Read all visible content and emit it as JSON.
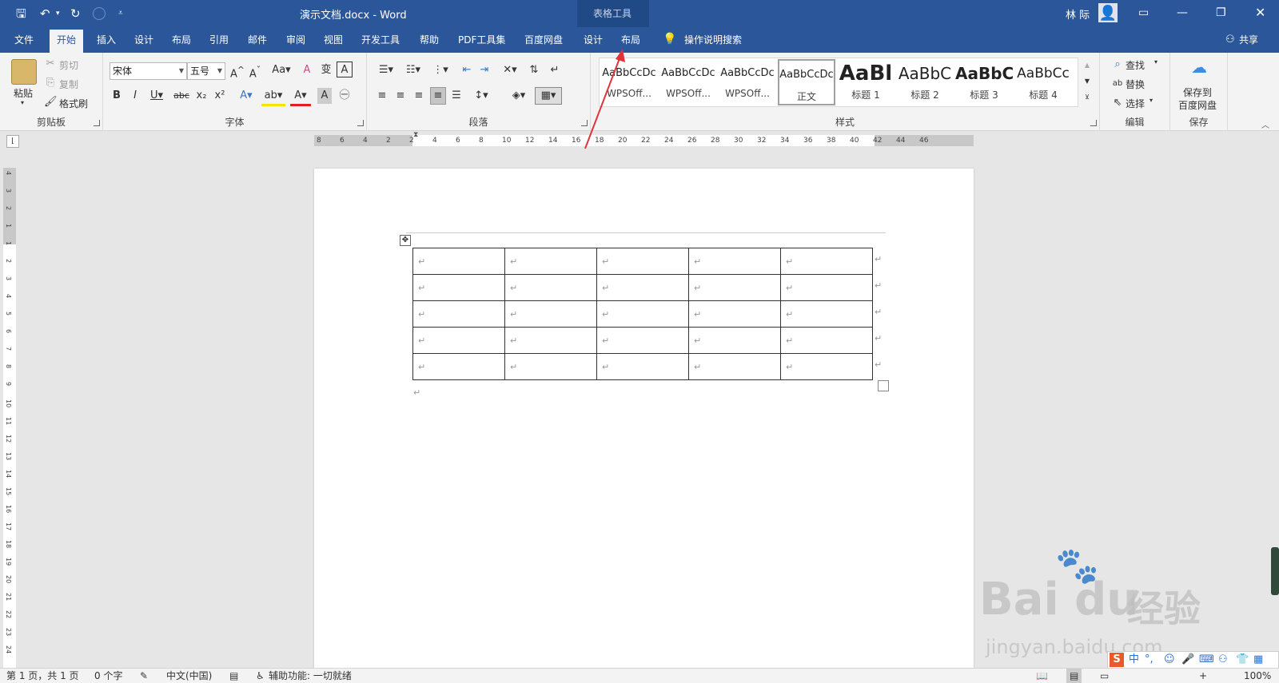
{
  "title": {
    "document": "演示文档.docx",
    "sep": "-",
    "app": "Word",
    "context_group": "表格工具",
    "user": "林 际"
  },
  "tabs": [
    "文件",
    "开始",
    "插入",
    "设计",
    "布局",
    "引用",
    "邮件",
    "审阅",
    "视图",
    "开发工具",
    "帮助",
    "PDF工具集",
    "百度网盘",
    "设计",
    "布局"
  ],
  "tell_me": "操作说明搜索",
  "share": "共享",
  "ribbon": {
    "clipboard": {
      "label": "剪贴板",
      "paste": "粘贴",
      "cut": "剪切",
      "copy": "复制",
      "painter": "格式刷"
    },
    "font": {
      "label": "字体",
      "name": "宋体",
      "size": "五号"
    },
    "paragraph": {
      "label": "段落"
    },
    "styles": {
      "label": "样式",
      "items": [
        {
          "preview": "AaBbCcDc",
          "name": "WPSOff..."
        },
        {
          "preview": "AaBbCcDc",
          "name": "WPSOff..."
        },
        {
          "preview": "AaBbCcDc",
          "name": "WPSOff..."
        },
        {
          "preview": "AaBbCcDc",
          "name": "正文"
        },
        {
          "preview": "AaBl",
          "name": "标题 1"
        },
        {
          "preview": "AaBbC",
          "name": "标题 2"
        },
        {
          "preview": "AaBbC",
          "name": "标题 3"
        },
        {
          "preview": "AaBbCc",
          "name": "标题 4"
        }
      ]
    },
    "editing": {
      "label": "编辑",
      "find": "查找",
      "replace": "替换",
      "select": "选择"
    },
    "save": {
      "label": "保存",
      "button_line1": "保存到",
      "button_line2": "百度网盘"
    }
  },
  "ruler_h": [
    "8",
    "6",
    "4",
    "2",
    "2",
    "4",
    "6",
    "8",
    "10",
    "12",
    "14",
    "16",
    "18",
    "20",
    "22",
    "24",
    "26",
    "28",
    "30",
    "32",
    "34",
    "36",
    "38",
    "40",
    "42",
    "44",
    "46"
  ],
  "ruler_v": [
    "4",
    "3",
    "2",
    "1",
    "1",
    "2",
    "3",
    "4",
    "5",
    "6",
    "7",
    "8",
    "9",
    "10",
    "11",
    "12",
    "13",
    "14",
    "15",
    "16",
    "17",
    "18",
    "19",
    "20",
    "21",
    "22",
    "23",
    "24"
  ],
  "table": {
    "rows": 5,
    "cols": 5,
    "cell_mark": "↵"
  },
  "status": {
    "page": "第 1 页，共 1 页",
    "words": "0 个字",
    "lang": "中文(中国)",
    "accessibility": "辅助功能: 一切就绪",
    "zoom": "100%"
  },
  "watermark": {
    "brand": "Bai du",
    "brand_cn": "经验",
    "url": "jingyan.baidu.com"
  },
  "ime": {
    "lang": "中",
    "punct": "°,"
  },
  "colors": {
    "accent": "#2b579a",
    "context": "#1f4a85",
    "arrow": "#e0343a"
  }
}
